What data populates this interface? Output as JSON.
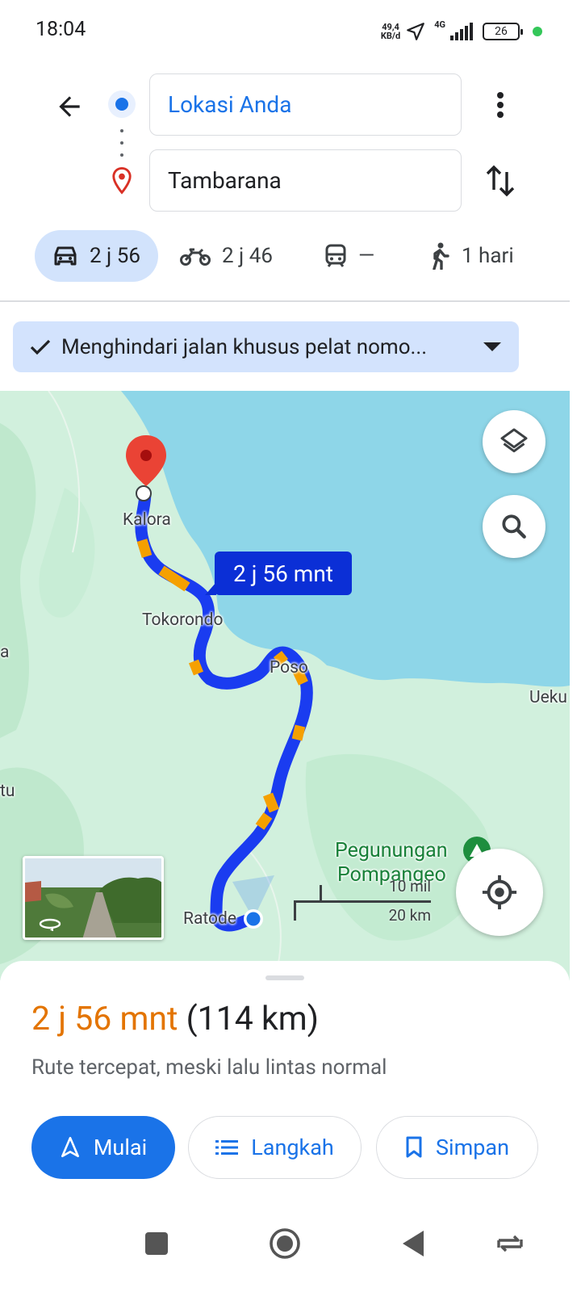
{
  "status_bar": {
    "time": "18:04",
    "net_speed_value": "49,4",
    "net_speed_unit": "KB/d",
    "network_type": "4G",
    "battery": "26"
  },
  "search": {
    "origin": "Lokasi Anda",
    "destination": "Tambarana"
  },
  "modes": [
    {
      "icon": "car-icon",
      "label": "2 j 56",
      "active": true
    },
    {
      "icon": "motorcycle-icon",
      "label": "2 j 46",
      "active": false
    },
    {
      "icon": "transit-icon",
      "label": "—",
      "active": false
    },
    {
      "icon": "walk-icon",
      "label": "1 hari",
      "active": false
    }
  ],
  "options_chip": {
    "label": "Menghindari jalan khusus pelat nomo..."
  },
  "map": {
    "eta_callout": "2 j 56 mnt",
    "labels": {
      "kalora": "Kalora",
      "tokorondo": "Tokorondo",
      "poso": "Poso",
      "ratode": "Ratode",
      "ueku": "Ueku",
      "a": "a",
      "tu": "tu",
      "pegunungan": "Pegunungan",
      "pompangeo": "Pompangeo"
    },
    "scale": {
      "imperial": "10 mil",
      "metric": "20 km"
    },
    "colors": {
      "water": "#8ed6e8",
      "land": "#d1f0dd",
      "route": "#1a3cf0",
      "traffic": "#f5a000"
    }
  },
  "sheet": {
    "duration": "2 j 56 mnt",
    "distance": "(114 km)",
    "subtext": "Rute tercepat, meski lalu lintas normal",
    "buttons": {
      "start": "Mulai",
      "steps": "Langkah",
      "save": "Simpan"
    }
  }
}
